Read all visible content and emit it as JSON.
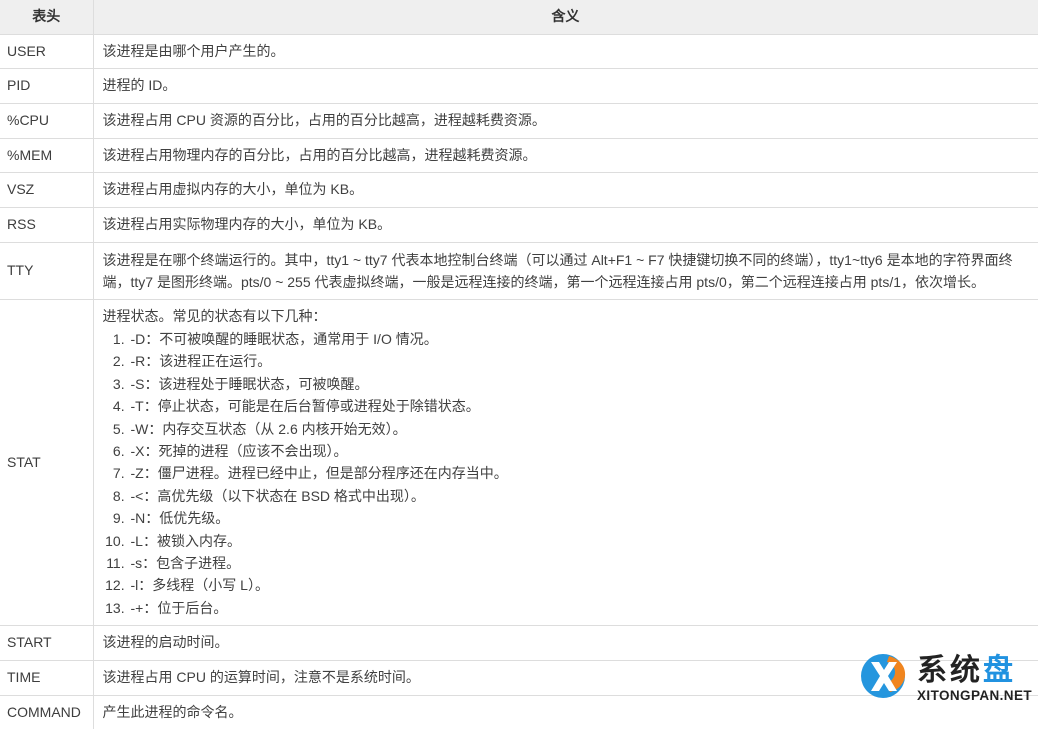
{
  "table": {
    "columns": [
      {
        "key": "head",
        "label": "表头",
        "align": "center"
      },
      {
        "key": "meaning",
        "label": "含义",
        "align": "center"
      }
    ],
    "rows": [
      {
        "head": "USER",
        "type": "text",
        "desc": "该进程是由哪个用户产生的。"
      },
      {
        "head": "PID",
        "type": "text",
        "desc": "进程的 ID。"
      },
      {
        "head": "%CPU",
        "type": "text",
        "desc": "该进程占用 CPU 资源的百分比，占用的百分比越高，进程越耗费资源。"
      },
      {
        "head": "%MEM",
        "type": "text",
        "desc": "该进程占用物理内存的百分比，占用的百分比越高，进程越耗费资源。"
      },
      {
        "head": "VSZ",
        "type": "text",
        "desc": "该进程占用虚拟内存的大小，单位为 KB。"
      },
      {
        "head": "RSS",
        "type": "text",
        "desc": "该进程占用实际物理内存的大小，单位为 KB。"
      },
      {
        "head": "TTY",
        "type": "text",
        "desc": "该进程是在哪个终端运行的。其中，tty1 ~ tty7 代表本地控制台终端（可以通过 Alt+F1 ~ F7 快捷键切换不同的终端），tty1~tty6 是本地的字符界面终端，tty7 是图形终端。pts/0 ~ 255 代表虚拟终端，一般是远程连接的终端，第一个远程连接占用 pts/0，第二个远程连接占用 pts/1，依次增长。"
      },
      {
        "head": "STAT",
        "type": "list",
        "intro": "进程状态。常见的状态有以下几种：",
        "items": [
          "-D：不可被唤醒的睡眠状态，通常用于 I/O 情况。",
          "-R：该进程正在运行。",
          "-S：该进程处于睡眠状态，可被唤醒。",
          "-T：停止状态，可能是在后台暂停或进程处于除错状态。",
          "-W：内存交互状态（从 2.6 内核开始无效）。",
          "-X：死掉的进程（应该不会出现）。",
          "-Z：僵尸进程。进程已经中止，但是部分程序还在内存当中。",
          "-<：高优先级（以下状态在 BSD 格式中出现）。",
          "-N：低优先级。",
          "-L：被锁入内存。",
          "-s：包含子进程。",
          "-l：多线程（小写 L）。",
          "-+：位于后台。"
        ]
      },
      {
        "head": "START",
        "type": "text",
        "desc": "该进程的启动时间。"
      },
      {
        "head": "TIME",
        "type": "text",
        "desc": "该进程占用 CPU 的运算时间，注意不是系统时间。"
      },
      {
        "head": "COMMAND",
        "type": "text",
        "desc": "产生此进程的命令名。"
      }
    ]
  },
  "watermark": {
    "cn_dark": "系统",
    "cn_blue": "盘",
    "en": "XITONGPAN.NET",
    "logo_icon": "xitongpan-logo-icon",
    "colors": {
      "logo_blue": "#1e93dd",
      "logo_orange": "#f08218",
      "text_blue": "#1a8fe0",
      "text_dark": "#1b1b1b"
    }
  },
  "theme": {
    "header_bg": "#efefef",
    "border": "#dddddd",
    "text": "#404040",
    "page_bg": "#ffffff"
  }
}
